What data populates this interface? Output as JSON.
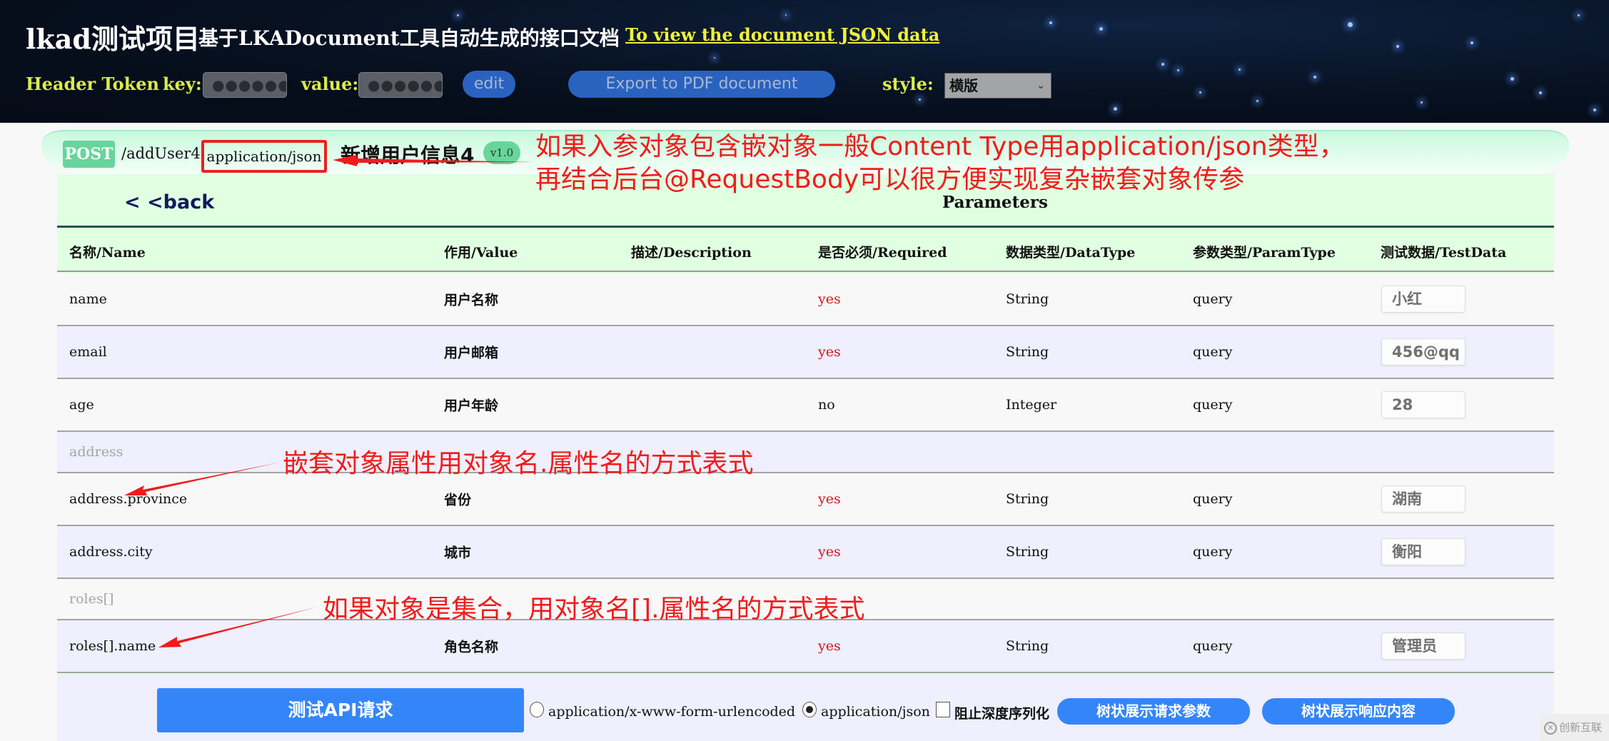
{
  "header": {
    "project_title": "lkad测试项目",
    "subtitle": "基于LKADocument工具自动生成的接口文档",
    "json_link": "To view the document JSON data",
    "token_label": "Header Token",
    "key_label": "key:",
    "key_value": "●●●●●●",
    "value_label": "value:",
    "value_value": "●●●●●●",
    "edit_button": "edit",
    "export_button": "Export to PDF document",
    "style_label": "style:",
    "style_selected": "横版"
  },
  "api": {
    "method": "POST",
    "path": "/addUser4",
    "content_type": "application/json",
    "name": "新增用户信息4",
    "version": "v1.0",
    "back_link": "< <back",
    "params_title": "Parameters"
  },
  "table": {
    "columns": [
      "名称/Name",
      "作用/Value",
      "描述/Description",
      "是否必须/Required",
      "数据类型/DataType",
      "参数类型/ParamType",
      "测试数据/TestData"
    ],
    "rows": [
      {
        "name": "name",
        "value": "用户名称",
        "description": "",
        "required": "yes",
        "datatype": "String",
        "paramtype": "query",
        "testdata": "小红"
      },
      {
        "name": "email",
        "value": "用户邮箱",
        "description": "",
        "required": "yes",
        "datatype": "String",
        "paramtype": "query",
        "testdata": "456@qq"
      },
      {
        "name": "age",
        "value": "用户年龄",
        "description": "",
        "required": "no",
        "datatype": "Integer",
        "paramtype": "query",
        "testdata": "28"
      },
      {
        "name": "address",
        "group": true
      },
      {
        "name": "address.province",
        "value": "省份",
        "description": "",
        "required": "yes",
        "datatype": "String",
        "paramtype": "query",
        "testdata": "湖南"
      },
      {
        "name": "address.city",
        "value": "城市",
        "description": "",
        "required": "yes",
        "datatype": "String",
        "paramtype": "query",
        "testdata": "衡阳"
      },
      {
        "name": "roles[]",
        "group": true
      },
      {
        "name": "roles[].name",
        "value": "角色名称",
        "description": "",
        "required": "yes",
        "datatype": "String",
        "paramtype": "query",
        "testdata": "管理员"
      }
    ]
  },
  "footer": {
    "test_button": "测试API请求",
    "radio_form": "application/x-www-form-urlencoded",
    "radio_json": "application/json",
    "radio_selected": "application/json",
    "checkbox_label": "阻止深度序列化",
    "checkbox_checked": false,
    "tree_request_button": "树状展示请求参数",
    "tree_response_button": "树状展示响应内容"
  },
  "annotations": {
    "top_line1": "如果入参对象包含嵌对象一般Content Type用application/json类型，",
    "top_line2": "再结合后台@RequestBody可以很方便实现复杂嵌套对象传参",
    "nested": "嵌套对象属性用对象名.属性名的方式表式",
    "collection": "如果对象是集合，用对象名[].属性名的方式表式",
    "color": "#f01c1c"
  },
  "watermark": {
    "text": "创新互联"
  }
}
